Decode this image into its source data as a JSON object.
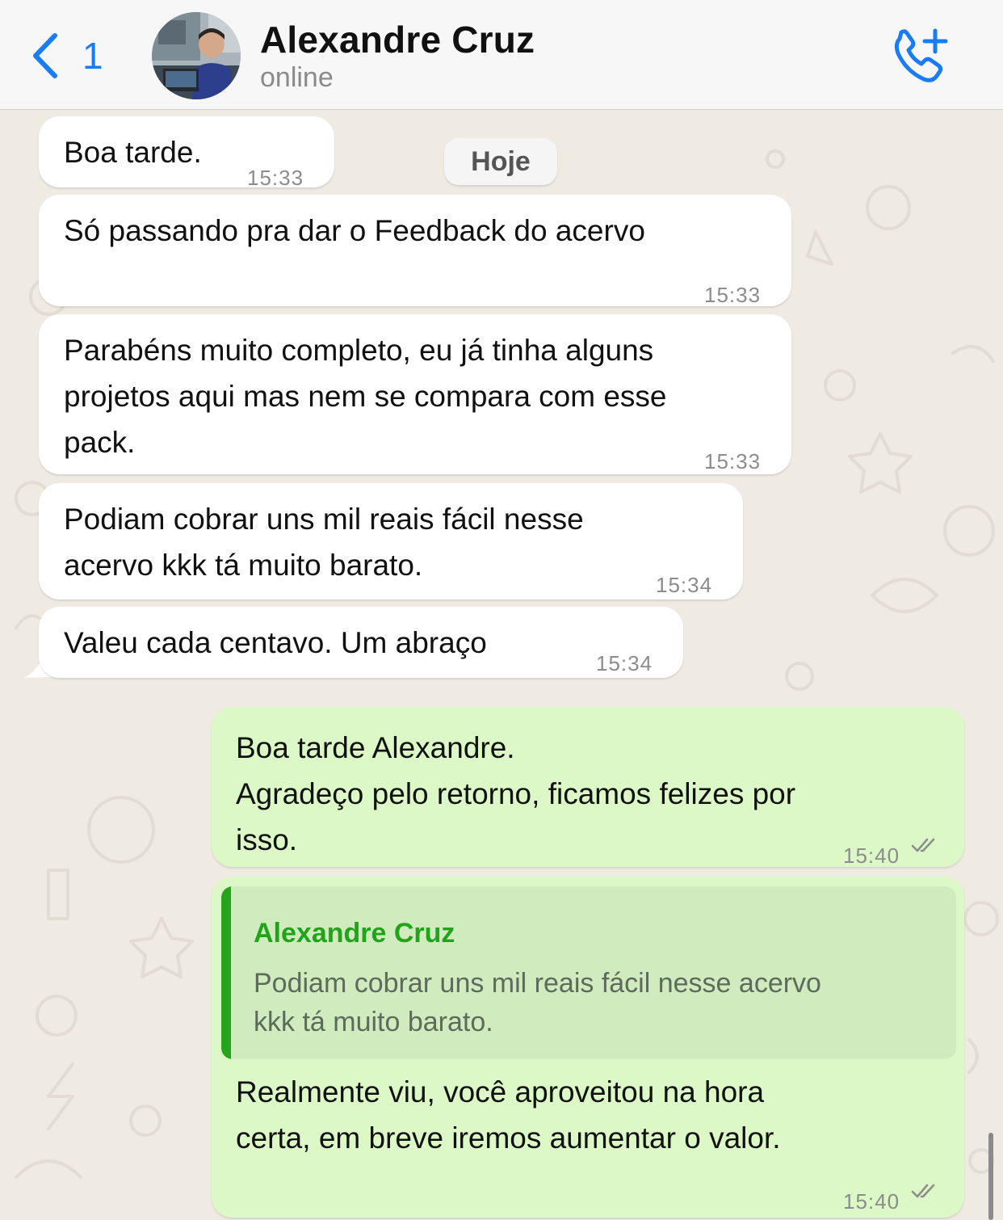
{
  "header": {
    "back_count": "1",
    "contact_name": "Alexandre Cruz",
    "status": "online"
  },
  "date_separator": "Hoje",
  "messages": [
    {
      "direction": "in",
      "text": "Boa tarde.",
      "time": "15:33"
    },
    {
      "direction": "in",
      "text": "Só passando pra dar o Feedback do acervo",
      "time": "15:33"
    },
    {
      "direction": "in",
      "text": "Parabéns muito completo, eu já tinha alguns\nprojetos aqui mas nem se compara com esse\npack.",
      "time": "15:33"
    },
    {
      "direction": "in",
      "text": "Podiam cobrar uns mil reais fácil nesse\nacervo kkk tá muito barato.",
      "time": "15:34"
    },
    {
      "direction": "in",
      "text": "Valeu cada centavo. Um abraço",
      "time": "15:34"
    },
    {
      "direction": "out",
      "text": "Boa tarde Alexandre.\nAgradeço pelo retorno, ficamos felizes por\nisso.",
      "time": "15:40",
      "read": true
    },
    {
      "direction": "out",
      "quote": {
        "author": "Alexandre Cruz",
        "text": "Podiam cobrar uns mil reais fácil nesse acervo\nkkk tá muito barato."
      },
      "text": "Realmente viu, você aproveitou na hora\ncerta, em breve iremos aumentar o valor.",
      "time": "15:40",
      "read": true
    }
  ],
  "colors": {
    "accent_blue": "#1a7cf4",
    "incoming_bubble": "#ffffff",
    "outgoing_bubble": "#dcf8c6",
    "quote_author": "#21a31a",
    "chat_background": "#efeae2"
  },
  "icons": [
    "back-chevron-icon",
    "add-call-icon",
    "read-ticks-icon"
  ]
}
